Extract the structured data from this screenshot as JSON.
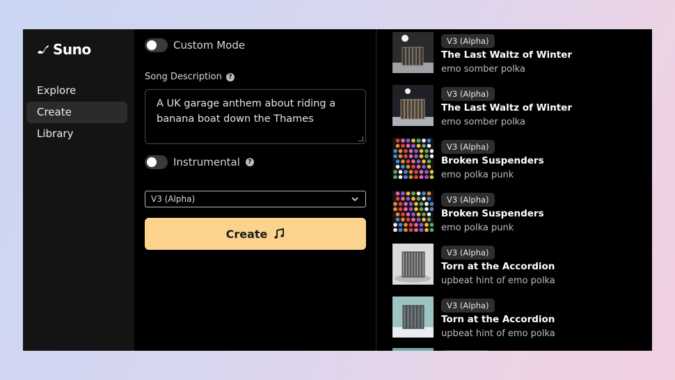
{
  "brand": {
    "name": "Suno"
  },
  "sidebar": {
    "items": [
      {
        "label": "Explore",
        "active": false
      },
      {
        "label": "Create",
        "active": true
      },
      {
        "label": "Library",
        "active": false
      }
    ]
  },
  "create_panel": {
    "custom_mode_label": "Custom Mode",
    "song_description_label": "Song Description",
    "song_description_value": "A UK garage anthem about riding a banana boat down the Thames",
    "instrumental_label": "Instrumental",
    "model_select_value": "V3 (Alpha)",
    "create_button_label": "Create",
    "accent_color": "#fbd38d"
  },
  "songs": [
    {
      "badge": "V3 (Alpha)",
      "title": "The Last Waltz of Winter",
      "style": "emo somber polka",
      "thumb": "snowy-accordion-moon"
    },
    {
      "badge": "V3 (Alpha)",
      "title": "The Last Waltz of Winter",
      "style": "emo somber polka",
      "thumb": "snowy-accordion-moon"
    },
    {
      "badge": "V3 (Alpha)",
      "title": "Broken Suspenders",
      "style": "emo polka punk",
      "thumb": "polka-dots"
    },
    {
      "badge": "V3 (Alpha)",
      "title": "Broken Suspenders",
      "style": "emo polka punk",
      "thumb": "polka-dots"
    },
    {
      "badge": "V3 (Alpha)",
      "title": "Torn at the Accordion",
      "style": "upbeat hint of emo polka",
      "thumb": "sketch-accordion"
    },
    {
      "badge": "V3 (Alpha)",
      "title": "Torn at the Accordion",
      "style": "upbeat hint of emo polka",
      "thumb": "teal-accordion"
    }
  ]
}
